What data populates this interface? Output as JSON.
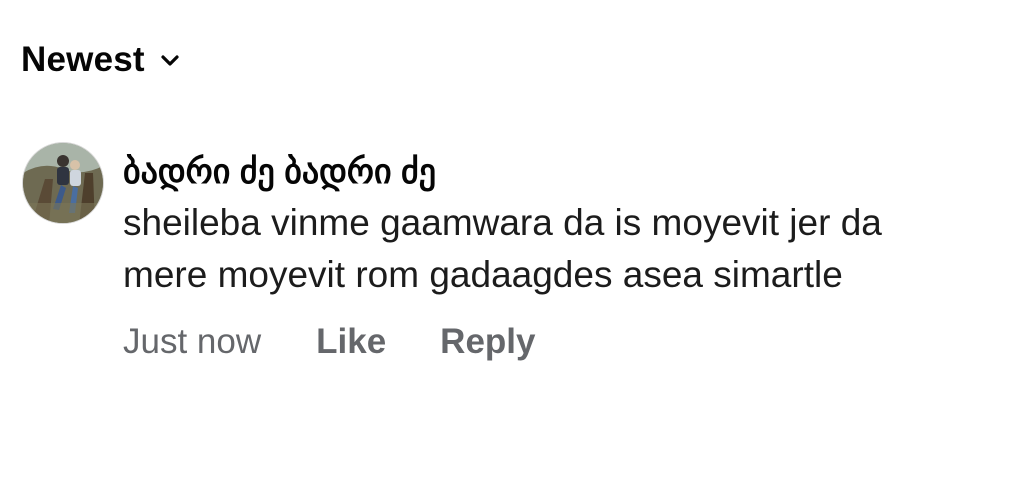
{
  "sort": {
    "label": "Newest",
    "icon": "chevron-down-icon"
  },
  "comment": {
    "author": "ბადრი ძე ბადრი ძე",
    "text": "sheileba vinme gaamwara da is moyevit jer da mere moyevit rom gadaagdes asea simartle",
    "time": "Just now",
    "like_label": "Like",
    "reply_label": "Reply"
  },
  "colors": {
    "text_primary": "#050505",
    "text_secondary": "#65676b",
    "background": "#ffffff"
  }
}
